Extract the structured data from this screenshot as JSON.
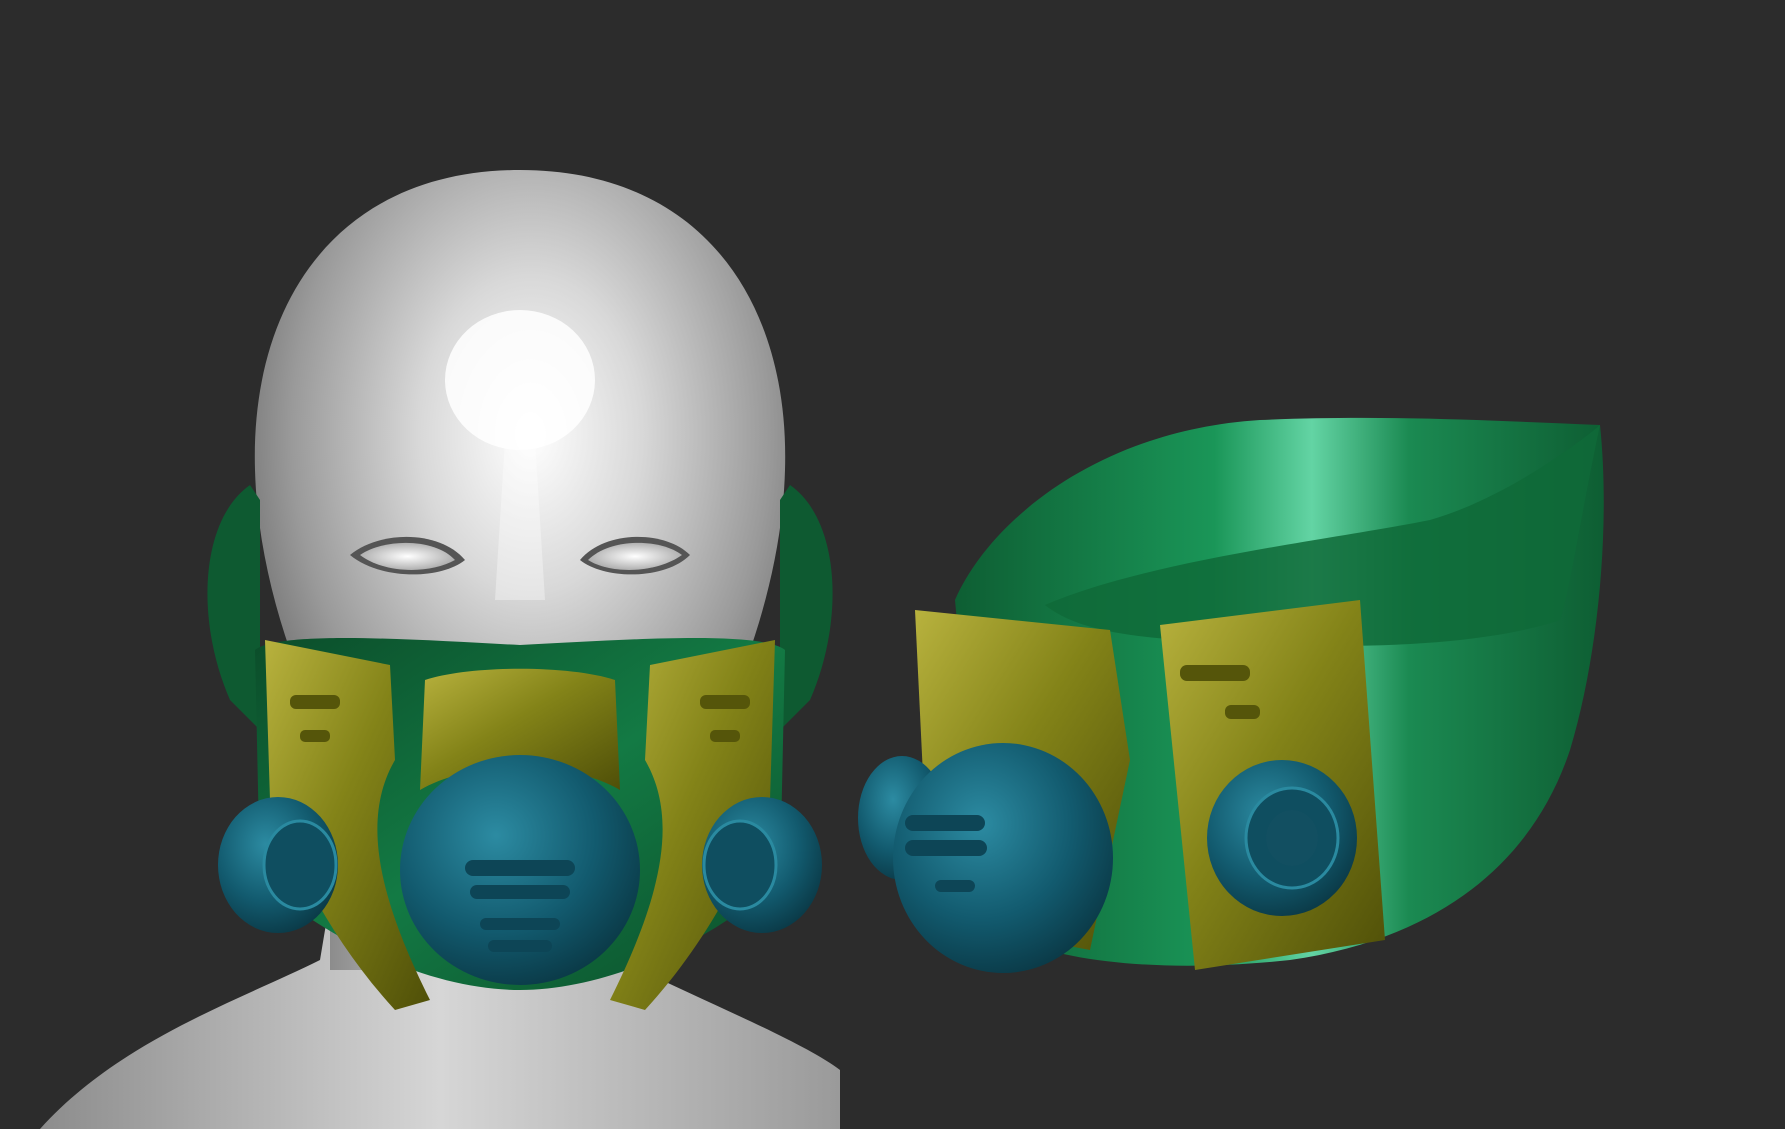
{
  "scene": {
    "background": "#2c2c2c",
    "objects": [
      {
        "name": "head-with-respirator",
        "view": "front"
      },
      {
        "name": "respirator-mask",
        "view": "three-quarter"
      }
    ],
    "colors": {
      "head": "#c8c8c8",
      "head_highlight": "#ffffff",
      "shell_green": "#0f6b3a",
      "shell_green_light": "#3fbf86",
      "frame_olive": "#6e6e14",
      "frame_olive_light": "#b3ad3a",
      "filter_teal": "#0f4e60",
      "filter_teal_light": "#2a8aa0"
    }
  }
}
